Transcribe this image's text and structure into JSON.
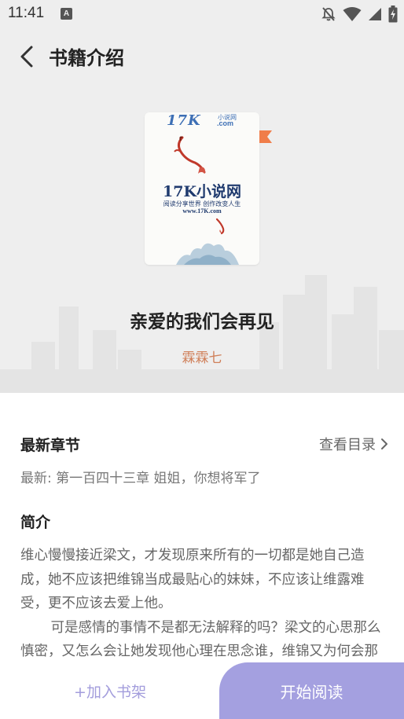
{
  "status_bar": {
    "time": "11:41",
    "notification_badge": "A",
    "icons": [
      "notification-off-icon",
      "wifi-icon",
      "signal-icon",
      "battery-charging-icon"
    ]
  },
  "header": {
    "back_icon": "chevron-left-icon",
    "title": "书籍介绍"
  },
  "book": {
    "cover": {
      "logo_text": "17K",
      "logo_sub": "小说网",
      "logo_domain": ".com",
      "name": "17K小说网",
      "slogan": "阅读分享世界 创作改变人生",
      "url": "www.17K.com",
      "flag_color": "#f07d4a"
    },
    "title": "亲爱的我们会再见",
    "author": "霖霖七"
  },
  "latest_chapter": {
    "heading": "最新章节",
    "catalog_link": "查看目录",
    "catalog_icon": "chevron-right-icon",
    "text": "最新: 第一百四十三章 姐姐，你想将军了"
  },
  "intro": {
    "heading": "简介",
    "paragraphs": [
      "维心慢慢接近梁文，才发现原来所有的一切都是她自己造成，她不应该把维锦当成最贴心的妹妹，不应该让维露难受，更不应该去爱上他。",
      "可是感情的事情不是都无法解释的吗？梁文的心思那么慎密，又怎么会让她发现他心理在思念谁，维锦又为何会那么做呢。"
    ]
  },
  "bottom": {
    "add_shelf": "+加入书架",
    "start_read": "开始阅读"
  },
  "colors": {
    "accent": "#a4a0e0",
    "author": "#d0805a",
    "hero_bg": "#eeeeee"
  }
}
